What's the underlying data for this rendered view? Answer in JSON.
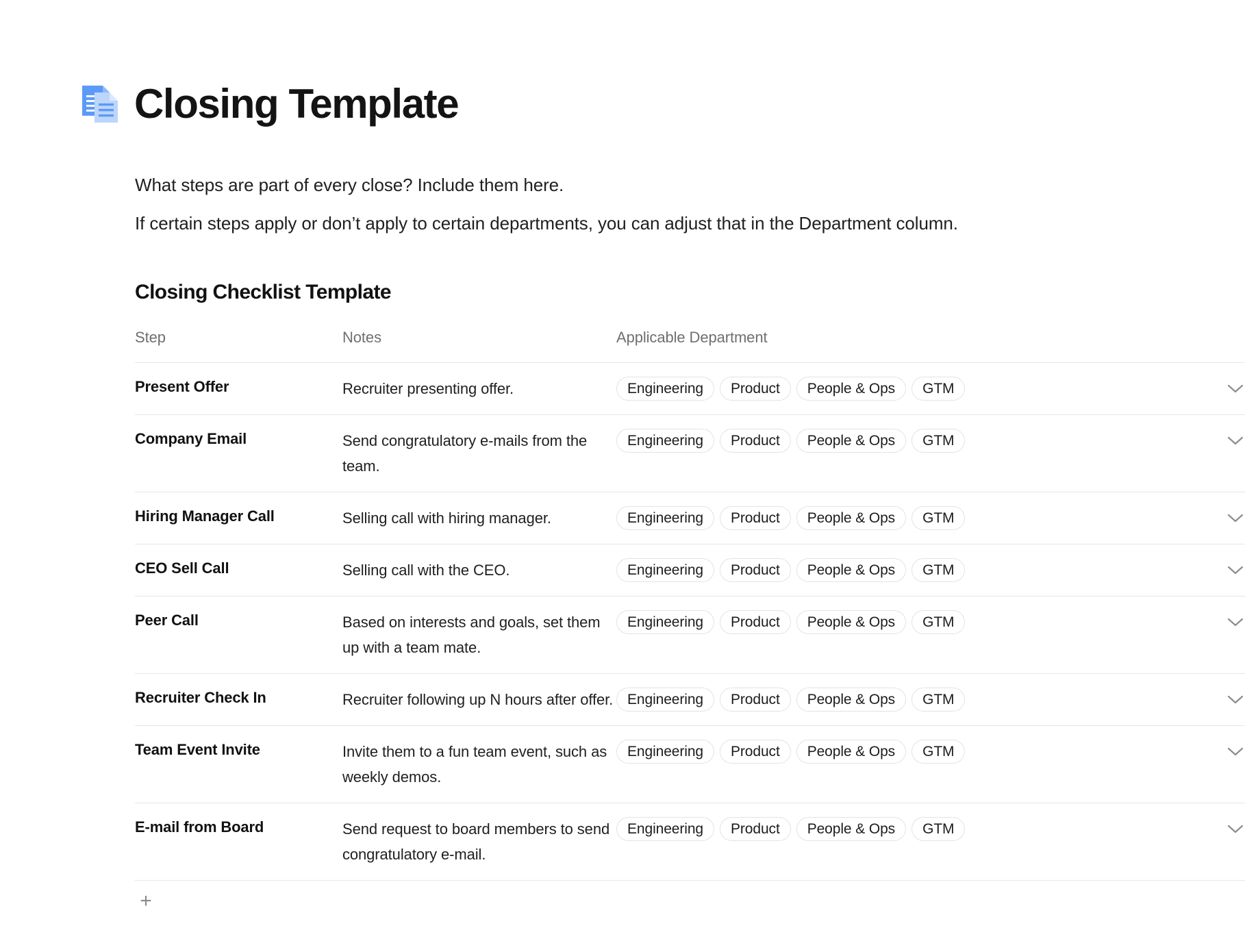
{
  "document": {
    "icon": "document-pages-icon",
    "title": "Closing Template",
    "paragraphs": [
      "What steps are part of every close? Include them here.",
      "If certain steps apply or don’t apply to certain departments, you can adjust that in the Department column."
    ],
    "section_heading": "Closing Checklist Template"
  },
  "table": {
    "columns": [
      "Step",
      "Notes",
      "Applicable Department"
    ],
    "row_expand_icon": "chevron-down-icon",
    "add_row_label": "+",
    "departments": [
      "Engineering",
      "Product",
      "People & Ops",
      "GTM"
    ],
    "rows": [
      {
        "step": "Present Offer",
        "notes": "Recruiter presenting offer.",
        "departments": [
          "Engineering",
          "Product",
          "People & Ops",
          "GTM"
        ]
      },
      {
        "step": "Company Email",
        "notes": "Send congratulatory e-mails from the team.",
        "departments": [
          "Engineering",
          "Product",
          "People & Ops",
          "GTM"
        ]
      },
      {
        "step": "Hiring Manager Call",
        "notes": "Selling call with hiring manager.",
        "departments": [
          "Engineering",
          "Product",
          "People & Ops",
          "GTM"
        ]
      },
      {
        "step": "CEO Sell Call",
        "notes": "Selling call with the CEO.",
        "departments": [
          "Engineering",
          "Product",
          "People & Ops",
          "GTM"
        ]
      },
      {
        "step": "Peer Call",
        "notes": "Based on interests and goals, set them up with a team mate.",
        "departments": [
          "Engineering",
          "Product",
          "People & Ops",
          "GTM"
        ]
      },
      {
        "step": "Recruiter Check In",
        "notes": "Recruiter following up N hours after offer.",
        "departments": [
          "Engineering",
          "Product",
          "People & Ops",
          "GTM"
        ]
      },
      {
        "step": "Team Event Invite",
        "notes": "Invite them to a fun team event, such as weekly demos.",
        "departments": [
          "Engineering",
          "Product",
          "People & Ops",
          "GTM"
        ]
      },
      {
        "step": "E-mail from Board",
        "notes": "Send request to board members to send congratulatory e-mail.",
        "departments": [
          "Engineering",
          "Product",
          "People & Ops",
          "GTM"
        ]
      }
    ]
  },
  "colors": {
    "page_background": "#ffffff",
    "text_primary": "#1d1d1d",
    "text_muted": "#6f6f6f",
    "rule": "#e6e6e6",
    "pill_border": "#e3e3e3",
    "icon_blue_dark": "#4285f4",
    "icon_blue_light": "#a8c7fa"
  }
}
